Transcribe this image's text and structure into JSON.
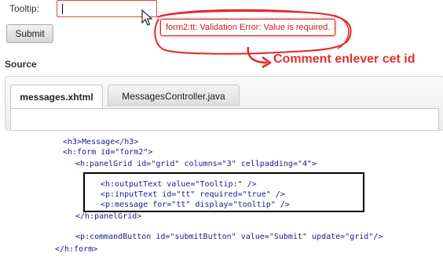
{
  "form": {
    "tooltip_label": "Tooltip:",
    "tooltip_input_value": "",
    "submit_label": "Submit",
    "error_message": "form2:tt: Validation Error: Value is required."
  },
  "annotation": {
    "text": "Comment enlever cet id",
    "color": "#e03030"
  },
  "source": {
    "title": "Source",
    "tabs": [
      {
        "label": "messages.xhtml",
        "active": true
      },
      {
        "label": "MessagesController.java",
        "active": false
      }
    ]
  },
  "code_lines": [
    "<h3>Message</h3>",
    "<h:form id=\"form2\">",
    "<h:panelGrid id=\"grid\" columns=\"3\" cellpadding=\"4\">",
    "<h:outputText value=\"Tooltip:\" />",
    "<p:inputText id=\"tt\" required=\"true\" />",
    "<p:message for=\"tt\" display=\"tooltip\" />",
    "</h:panelGrid>",
    "<p:commandButton id=\"submitButton\" value=\"Submit\" update=\"grid\"/>",
    "</h:form>"
  ],
  "colors": {
    "error_border": "#cc2b2b",
    "error_text": "#c02020",
    "input_border": "#d84a4a"
  },
  "icons": [
    "mouse-pointer-icon",
    "red-arrow-icon"
  ]
}
